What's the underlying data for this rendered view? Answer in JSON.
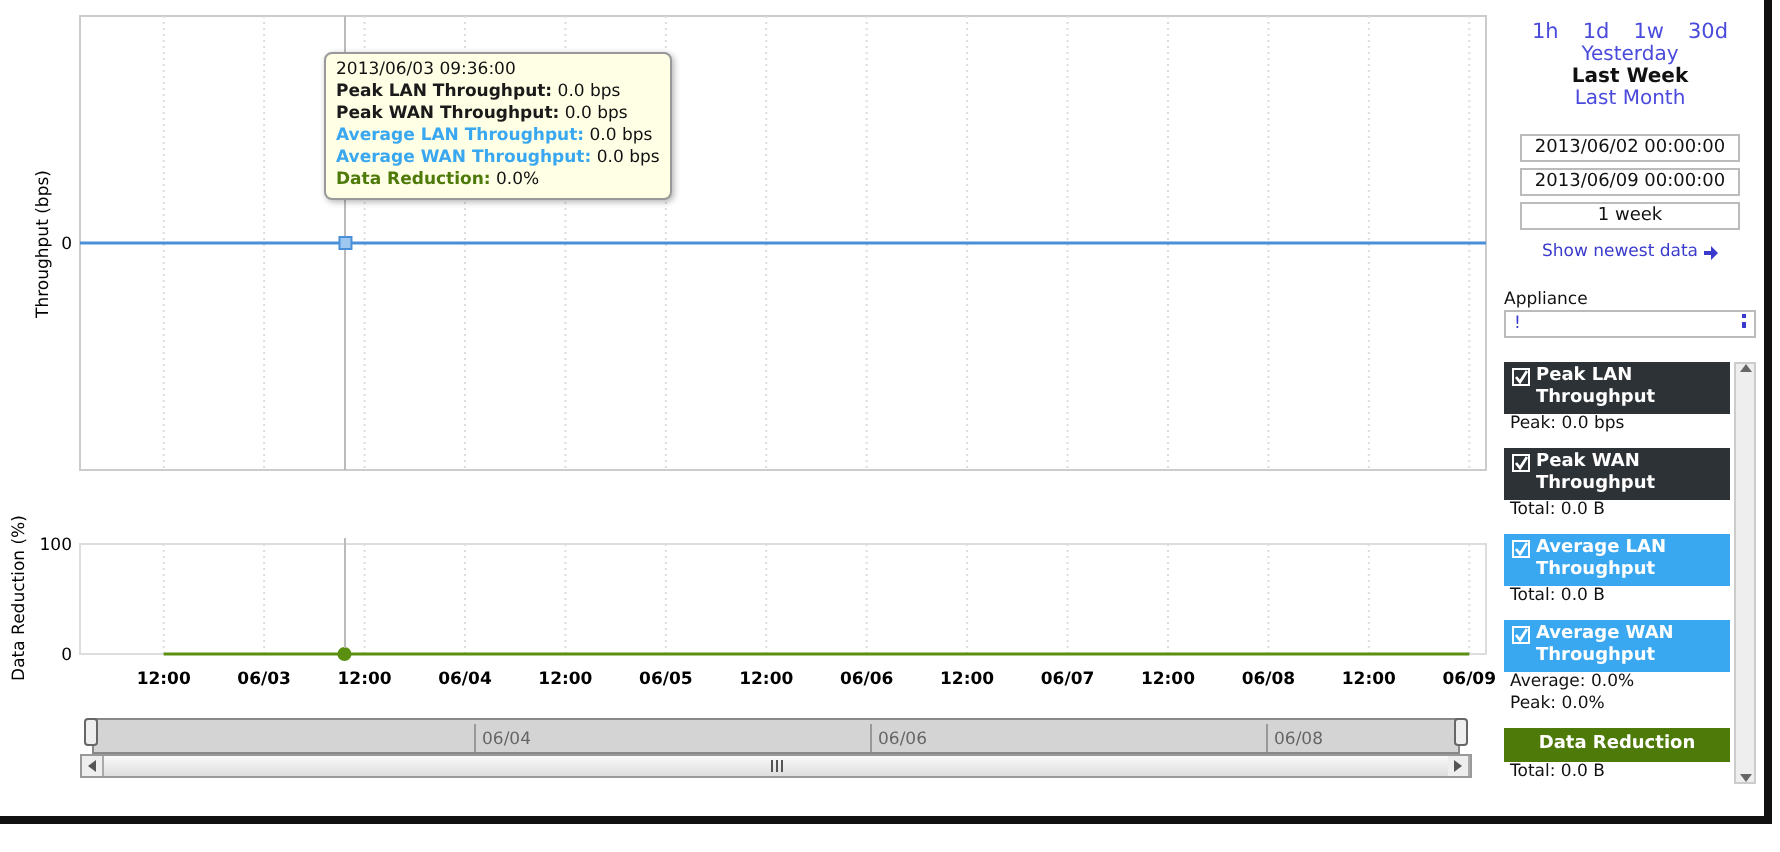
{
  "throughput_chart": {
    "ylabel": "Throughput (bps)",
    "tick": "0"
  },
  "tooltip": {
    "time": "2013/06/03 09:36:00",
    "lines": [
      {
        "label": "Peak LAN Throughput:",
        "value": "0.0 bps",
        "color": "#1a1a1a"
      },
      {
        "label": "Peak WAN Throughput:",
        "value": "0.0 bps",
        "color": "#1a1a1a"
      },
      {
        "label": "Average LAN Throughput:",
        "value": "0.0 bps",
        "color": "#3aa8f0"
      },
      {
        "label": "Average WAN Throughput:",
        "value": "0.0 bps",
        "color": "#3aa8f0"
      },
      {
        "label": "Data Reduction:",
        "value": "0.0%",
        "color": "#4e7a0a"
      }
    ]
  },
  "reduction_chart": {
    "chart_data": {
      "type": "line",
      "ylabel": "Data Reduction (%)",
      "ylim": [
        0,
        100
      ],
      "yticks": [
        0,
        100
      ],
      "grid": true,
      "categories": [
        null,
        "12:00",
        "06/03",
        "12:00",
        "06/04",
        "12:00",
        "06/05",
        "12:00",
        "06/06",
        "12:00",
        "06/07",
        "12:00",
        "06/08",
        "12:00",
        "06/09",
        null
      ],
      "series": [
        {
          "color": "#5a8f10",
          "values": [
            null,
            0,
            0,
            0,
            0,
            0,
            0,
            0,
            0,
            0,
            0,
            0,
            0,
            0,
            0,
            null
          ]
        }
      ]
    }
  },
  "navigator": {
    "labels": [
      "06/04",
      "06/06",
      "06/08"
    ]
  },
  "ranges": [
    {
      "label": "1h",
      "selected": false
    },
    {
      "label": "1d",
      "selected": false
    },
    {
      "label": "1w",
      "selected": false
    },
    {
      "label": "30d",
      "selected": false
    }
  ],
  "presets": [
    {
      "label": "Yesterday",
      "selected": false
    },
    {
      "label": "Last Week",
      "selected": true
    },
    {
      "label": "Last Month",
      "selected": false
    }
  ],
  "start": "2013/06/02 00:00:00",
  "end": "2013/06/09 00:00:00",
  "duration": "1 week",
  "newest_link": "Show newest data",
  "appliance": {
    "label": "Appliance",
    "value": "!"
  },
  "legend": [
    {
      "title": "Peak LAN Throughput",
      "color": "#2d3237",
      "checked": true,
      "stats": [
        "Peak: 0.0 bps"
      ]
    },
    {
      "title": "Peak WAN Throughput",
      "color": "#2d3237",
      "checked": true,
      "stats": [
        "Total: 0.0 B"
      ]
    },
    {
      "title": "Average LAN Throughput",
      "color": "#3aa8f0",
      "checked": true,
      "stats": [
        "Total: 0.0 B"
      ]
    },
    {
      "title": "Average WAN Throughput",
      "color": "#3aa8f0",
      "checked": true,
      "stats": [
        "Average: 0.0%",
        "Peak: 0.0%"
      ]
    },
    {
      "title": "Data Reduction",
      "color": "#4e7a0a",
      "stats": [
        "Total: 0.0 B"
      ]
    }
  ]
}
